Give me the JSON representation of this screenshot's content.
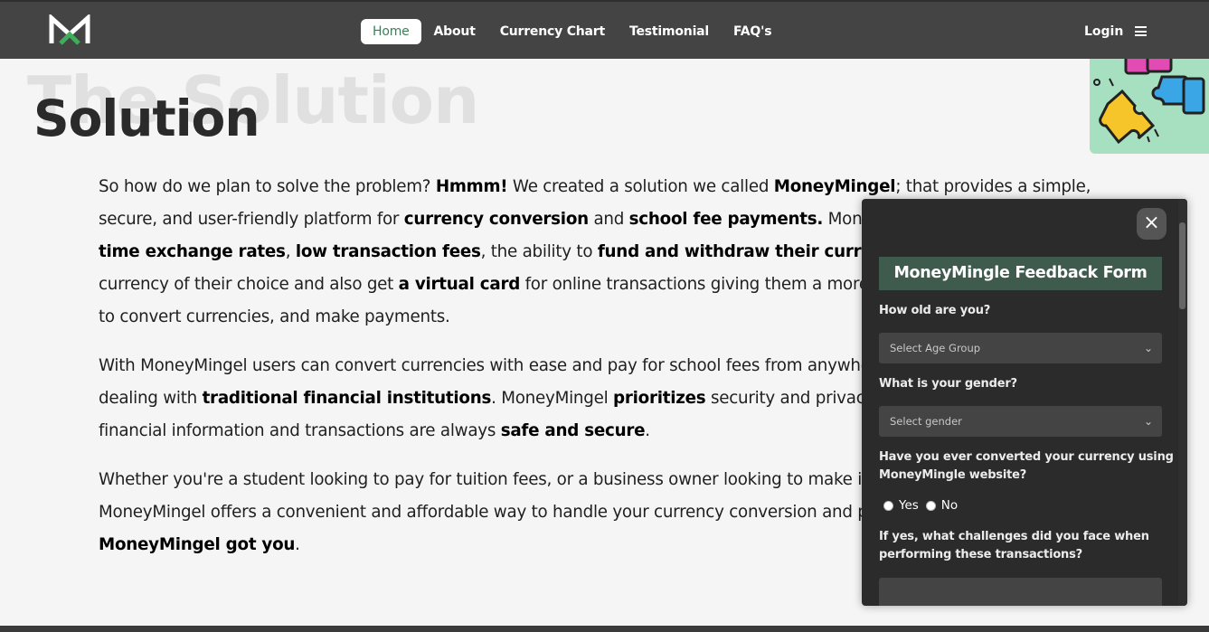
{
  "nav": {
    "logo": "M-logo-icon",
    "links": [
      "Home",
      "About",
      "Currency Chart",
      "Testimonial",
      "FAQ's"
    ],
    "login": "Login",
    "menu_icon": "hamburger-icon"
  },
  "hero": {
    "bg_title": "The Solution",
    "title": "Solution"
  },
  "content": {
    "p1": [
      {
        "t": "So how do we plan to solve the problem? "
      },
      {
        "t": "Hmmm!",
        "b": true
      },
      {
        "t": " We created a solution we called "
      },
      {
        "t": "MoneyMingel",
        "b": true
      },
      {
        "t": "; that provides a simple, secure, and user-friendly platform for "
      },
      {
        "t": "currency conversion",
        "b": true
      },
      {
        "t": " and "
      },
      {
        "t": "school fee payments.",
        "b": true
      },
      {
        "t": " MoneyMingel users get "
      },
      {
        "t": "real-time exchange rates",
        "b": true
      },
      {
        "t": ", "
      },
      {
        "t": "low transaction fees",
        "b": true
      },
      {
        "t": ", the ability to "
      },
      {
        "t": "fund and withdraw their currency",
        "b": true
      },
      {
        "t": ", send and receive currency of their choice and also get "
      },
      {
        "t": "a virtual card",
        "b": true
      },
      {
        "t": " for online transactions giving them a more convenient and easy way to convert currencies, and make payments."
      }
    ],
    "p2": [
      {
        "t": "With MoneyMingel users can convert currencies with ease and pay for school fees from anywhere without the hassle of dealing with "
      },
      {
        "t": "traditional financial institutions",
        "b": true
      },
      {
        "t": ". MoneyMingel "
      },
      {
        "t": "prioritizes",
        "b": true
      },
      {
        "t": " security and privacy, ensuring that users' financial information and transactions are always "
      },
      {
        "t": "safe and secure",
        "b": true
      },
      {
        "t": "."
      }
    ],
    "p3": [
      {
        "t": "Whether you're a student looking to pay for tuition fees, or a business owner looking to make international payments, MoneyMingel offers a convenient and affordable way to handle your currency conversion and payment needs. "
      },
      {
        "t": "MoneyMingel got you",
        "b": true
      },
      {
        "t": "."
      }
    ]
  },
  "feedback": {
    "close": "×",
    "title": "MoneyMingle Feedback Form",
    "q_age": "How old are you?",
    "age_placeholder": "Select Age Group",
    "q_gender": "What is your gender?",
    "gender_placeholder": "Select gender",
    "q_converted_1": "Have you ever converted your currency using",
    "q_converted_2": "MoneyMingle website?",
    "yes": "Yes",
    "no": "No",
    "q_challenges_1": "If yes, what challenges did you face when",
    "q_challenges_2": "performing these transactions?",
    "chevron": "⌄"
  }
}
